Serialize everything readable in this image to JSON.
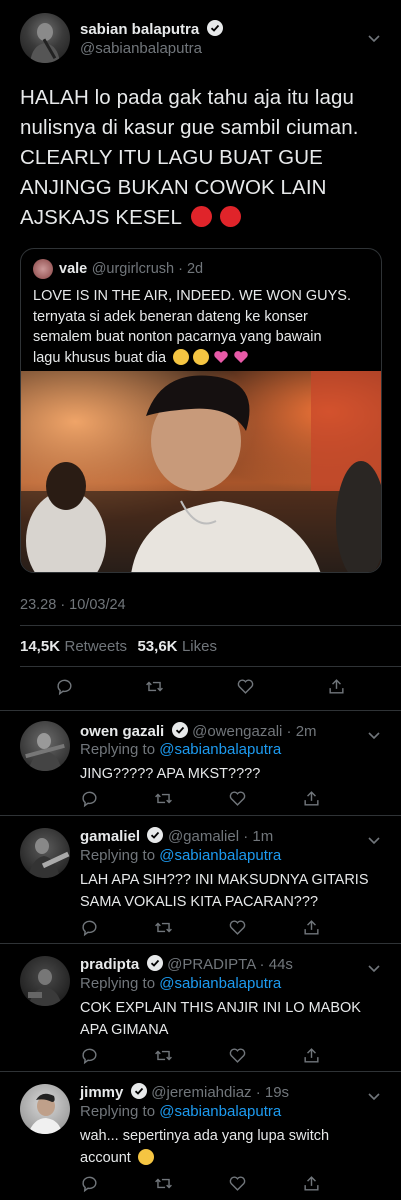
{
  "main_tweet": {
    "name": "sabian balaputra",
    "handle": "@sabianbalaputra",
    "text_lines": [
      "HALAH lo pada gak tahu aja itu lagu",
      "nulisnya di kasur gue sambil ciuman.",
      "CLEARLY ITU LAGU BUAT GUE",
      "ANJINGG BUKAN COWOK LAIN",
      "AJSKAJS KESEL"
    ],
    "quote": {
      "name": "vale",
      "handle_time": "@urgirlcrush · 2d",
      "lines": [
        "LOVE IS IN THE AIR, INDEED. WE WON GUYS.",
        "ternyata si adek beneran dateng ke konser",
        "semalem buat nonton pacarnya yang bawain",
        "lagu khusus buat dia"
      ]
    },
    "timestamp": "23.28 · 10/03/24",
    "retweets_count": "14,5K",
    "retweets_label": "Retweets",
    "likes_count": "53,6K",
    "likes_label": "Likes"
  },
  "replies": [
    {
      "name": "owen gazali",
      "handle_time": "@owengazali · 2m",
      "replying_prefix": "Replying to",
      "replying_to": "@sabianbalaputra",
      "lines": [
        "JING????? APA MKST????"
      ]
    },
    {
      "name": "gamaliel",
      "handle_time": "@gamaliel · 1m",
      "replying_prefix": "Replying to",
      "replying_to": "@sabianbalaputra",
      "lines": [
        "LAH APA SIH??? INI MAKSUDNYA GITARIS",
        "SAMA VOKALIS KITA PACARAN???"
      ]
    },
    {
      "name": "pradipta",
      "handle_time": "@PRADIPTA · 44s",
      "replying_prefix": "Replying to",
      "replying_to": "@sabianbalaputra",
      "lines": [
        "COK EXPLAIN THIS ANJIR INI LO MABOK",
        "APA GIMANA"
      ]
    },
    {
      "name": "jimmy",
      "handle_time": "@jeremiahdiaz · 19s",
      "replying_prefix": "Replying to",
      "replying_to": "@sabianbalaputra",
      "lines": [
        "wah... sepertinya ada yang lupa switch",
        "account"
      ]
    }
  ],
  "icons": {
    "verified": "verified-badge-icon",
    "chevron": "chevron-down-icon",
    "reply": "reply-icon",
    "retweet": "retweet-icon",
    "like": "heart-icon",
    "share": "share-icon"
  },
  "colors": {
    "background": "#000000",
    "text": "#e7e9ea",
    "muted": "#71767b",
    "link": "#1d9bf0",
    "divider": "#2f3336"
  }
}
